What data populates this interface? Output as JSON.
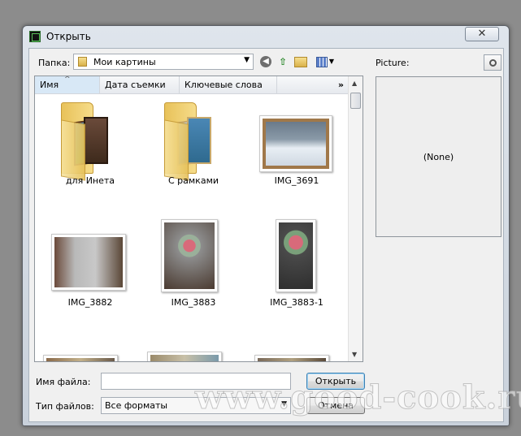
{
  "window": {
    "title": "Открыть",
    "close_glyph": "✕"
  },
  "toolbar": {
    "folder_label": "Папка:",
    "folder_value": "Мои картины",
    "dropdown_glyph": "▼",
    "back_glyph": "◀",
    "up_glyph": "⇧",
    "view_arrow": "▼"
  },
  "columns": {
    "name": "Имя",
    "date_taken": "Дата съемки",
    "keywords": "Ключевые слова",
    "more": "»",
    "sort_caret": "^"
  },
  "scrollbar": {
    "up": "▲",
    "down": "▼"
  },
  "items": [
    {
      "name": "для Инета",
      "kind": "folder"
    },
    {
      "name": "С рамками",
      "kind": "folder"
    },
    {
      "name": "IMG_3691",
      "kind": "image"
    },
    {
      "name": "IMG_3882",
      "kind": "image"
    },
    {
      "name": "IMG_3883",
      "kind": "image"
    },
    {
      "name": "IMG_3883-1",
      "kind": "image"
    }
  ],
  "preview": {
    "label": "Picture:",
    "empty_text": "(None)"
  },
  "filename": {
    "label": "Имя файла:",
    "value": ""
  },
  "filetype": {
    "label": "Тип файлов:",
    "value": "Все форматы",
    "dropdown_glyph": "▼"
  },
  "buttons": {
    "open": "Открыть",
    "cancel": "Отмена"
  },
  "watermark": "www.good-cook.ru",
  "colors": {
    "selection_header": "#d8e8f6",
    "default_button_border": "#3c7fb1"
  }
}
